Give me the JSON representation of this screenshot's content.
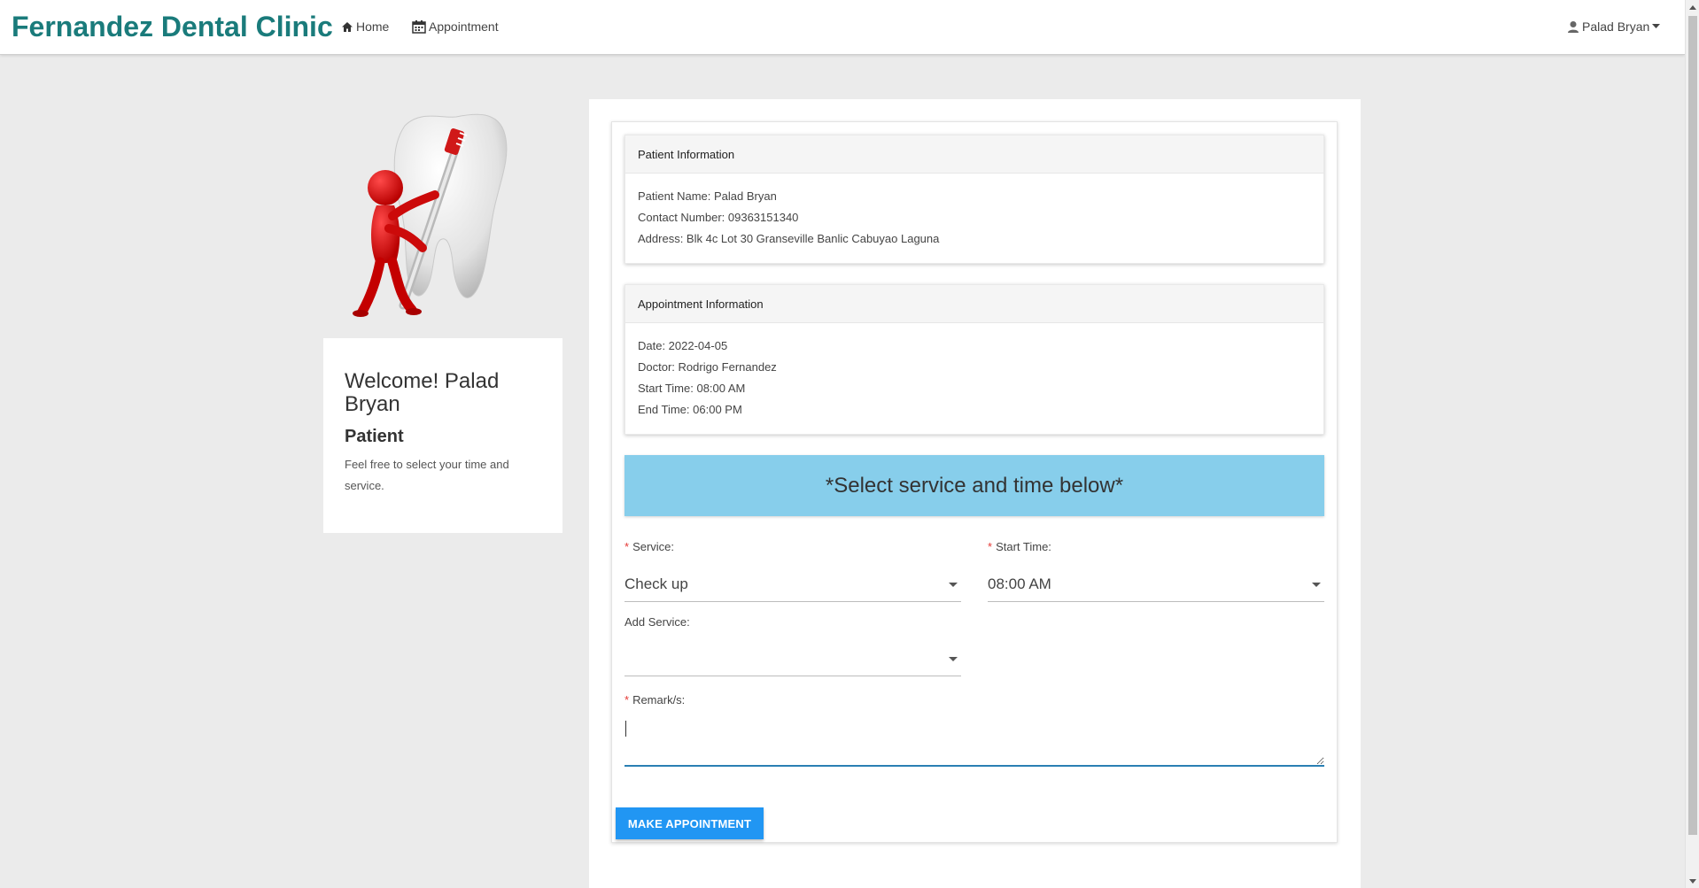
{
  "brand": "Fernandez Dental Clinic",
  "nav": {
    "home": "Home",
    "appointment": "Appointment",
    "user": "Palad Bryan"
  },
  "welcome": {
    "title": "Welcome! Palad Bryan",
    "role": "Patient",
    "text": "Feel free to select your time and service."
  },
  "patient_info": {
    "header": "Patient Information",
    "rows": [
      "Patient Name: Palad Bryan",
      "Contact Number: 09363151340",
      "Address: Blk 4c Lot 30 Granseville Banlic Cabuyao Laguna"
    ]
  },
  "appointment_info": {
    "header": "Appointment Information",
    "rows": [
      "Date: 2022-04-05",
      "Doctor: Rodrigo Fernandez",
      "Start Time: 08:00 AM",
      "End Time: 06:00 PM"
    ]
  },
  "banner": "*Select service and time below*",
  "form": {
    "required_mark": "*",
    "service_label": "Service:",
    "service_value": "Check up",
    "start_time_label": "Start Time:",
    "start_time_value": "08:00 AM",
    "add_service_label": "Add Service:",
    "add_service_value": "",
    "remarks_label": "Remark/s:",
    "remarks_value": "",
    "submit_label": "MAKE APPOINTMENT"
  },
  "colors": {
    "brand": "#1a7b7b",
    "banner": "#87ceeb",
    "button": "#2196f3",
    "required": "#e53935",
    "focus_underline": "#2a7fb3"
  },
  "icons": {
    "home": "home-icon",
    "appointment": "calendar-icon",
    "user": "user-icon",
    "dropdown": "caret-down-icon"
  }
}
